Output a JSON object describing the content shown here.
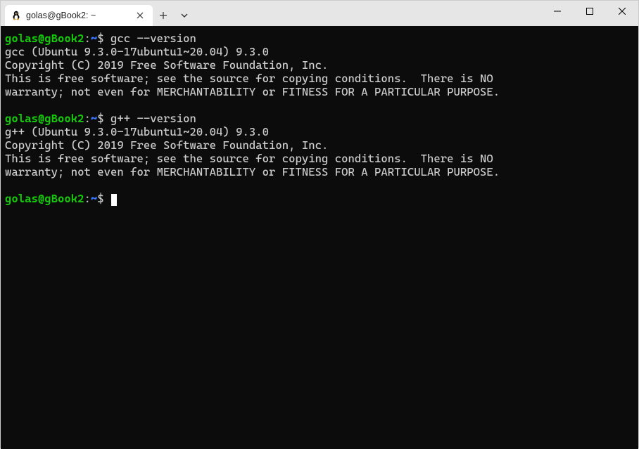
{
  "window": {
    "tab_title": "golas@gBook2: ~"
  },
  "prompt": {
    "userhost": "golas@gBook2",
    "colon": ":",
    "path": "~",
    "dollar": "$"
  },
  "blocks": [
    {
      "command": "gcc --version",
      "output": [
        "gcc (Ubuntu 9.3.0-17ubuntu1~20.04) 9.3.0",
        "Copyright (C) 2019 Free Software Foundation, Inc.",
        "This is free software; see the source for copying conditions.  There is NO",
        "warranty; not even for MERCHANTABILITY or FITNESS FOR A PARTICULAR PURPOSE.",
        ""
      ]
    },
    {
      "command": "g++ --version",
      "output": [
        "g++ (Ubuntu 9.3.0-17ubuntu1~20.04) 9.3.0",
        "Copyright (C) 2019 Free Software Foundation, Inc.",
        "This is free software; see the source for copying conditions.  There is NO",
        "warranty; not even for MERCHANTABILITY or FITNESS FOR A PARTICULAR PURPOSE.",
        ""
      ]
    }
  ]
}
